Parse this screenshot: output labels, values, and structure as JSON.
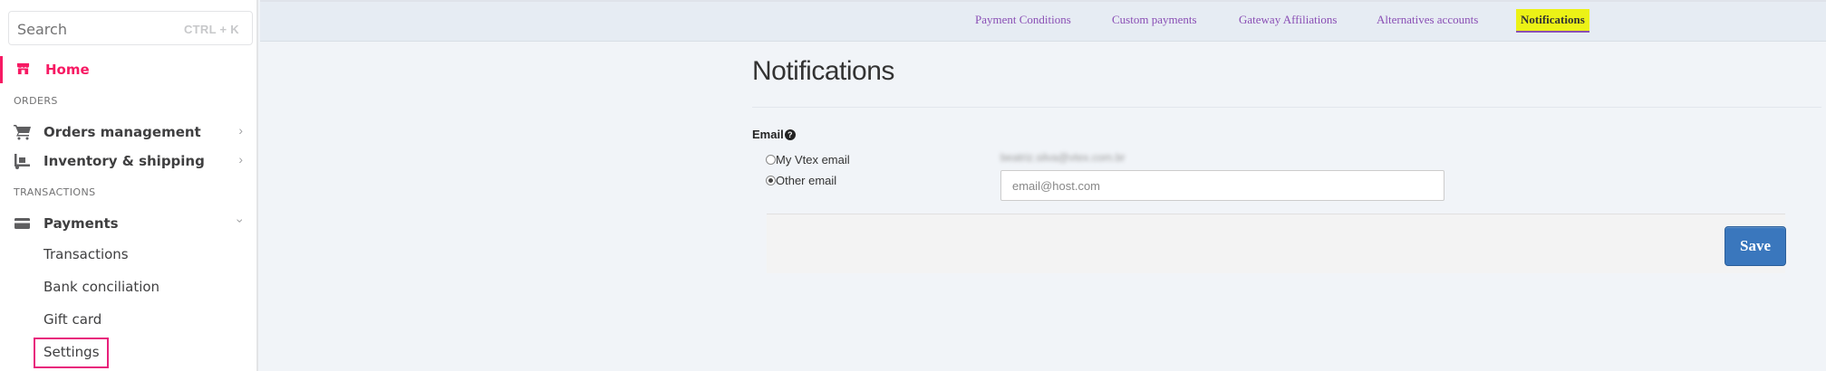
{
  "sidebar": {
    "search": {
      "placeholder": "Search",
      "shortcut": "CTRL + K"
    },
    "home": {
      "label": "Home",
      "icon": "store-icon"
    },
    "sections": {
      "orders": "ORDERS",
      "transactions": "TRANSACTIONS"
    },
    "items": [
      {
        "label": "Orders management",
        "icon": "cart-icon"
      },
      {
        "label": "Inventory & shipping",
        "icon": "dolly-icon"
      },
      {
        "label": "Payments",
        "icon": "card-icon"
      }
    ],
    "payments_sub": [
      {
        "label": "Transactions"
      },
      {
        "label": "Bank conciliation"
      },
      {
        "label": "Gift card"
      },
      {
        "label": "Settings"
      }
    ]
  },
  "tabs": [
    {
      "label": "Payment Conditions"
    },
    {
      "label": "Custom payments"
    },
    {
      "label": "Gateway Affiliations"
    },
    {
      "label": "Alternatives accounts"
    },
    {
      "label": "Notifications",
      "active": true
    }
  ],
  "main": {
    "title": "Notifications",
    "email_label": "Email",
    "options": [
      {
        "label": "My Vtex email",
        "selected": false,
        "value": "beatriz.silva@vtex.com.br"
      },
      {
        "label": "Other email",
        "selected": true
      }
    ],
    "email_placeholder": "email@host.com",
    "save_label": "Save"
  },
  "colors": {
    "brand_pink": "#f71963",
    "tab_purple": "#8a4fb5",
    "highlight_yellow": "#ecf216",
    "save_blue": "#3a77bd"
  }
}
